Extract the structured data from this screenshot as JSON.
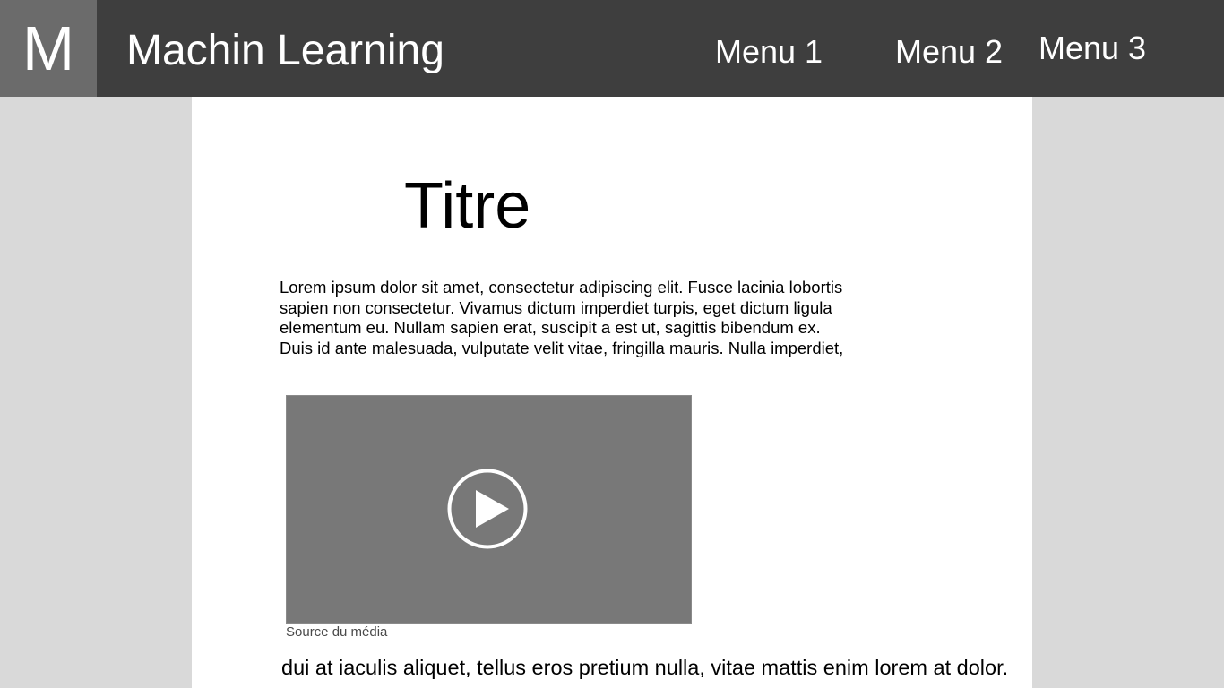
{
  "header": {
    "logo_letter": "M",
    "site_title": "Machin Learning",
    "menu": [
      {
        "label": "Menu 1"
      },
      {
        "label": "Menu 2"
      },
      {
        "label": "Menu 3"
      }
    ]
  },
  "article": {
    "title": "Titre",
    "intro_lines": [
      "Lorem ipsum dolor sit amet, consectetur adipiscing elit. Fusce lacinia lobortis",
      "sapien non consectetur. Vivamus dictum imperdiet turpis, eget dictum ligula",
      "elementum eu. Nullam sapien erat, suscipit a est ut, sagittis bibendum ex.",
      "Duis id ante malesuada, vulputate velit vitae, fringilla mauris. Nulla imperdiet,"
    ],
    "video": {
      "icon": "play-icon",
      "caption": "Source du média"
    },
    "body_lines": [
      "dui at iaculis aliquet, tellus eros pretium nulla, vitae mattis enim lorem at dolor."
    ]
  },
  "colors": {
    "topbar": "#3e3e3e",
    "logo_box": "#6b6b6b",
    "page_background": "#d9d9d9",
    "content_background": "#ffffff",
    "video_placeholder": "#787878"
  }
}
